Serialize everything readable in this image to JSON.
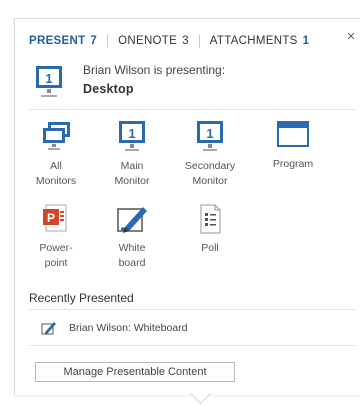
{
  "tabs": [
    {
      "label": "PRESENT",
      "count": "7"
    },
    {
      "label": "ONENOTE",
      "count": "3"
    },
    {
      "label": "ATTACHMENTS",
      "count": "1"
    }
  ],
  "close_glyph": "×",
  "presenting": {
    "status": "Brian Wilson is presenting:",
    "content": "Desktop",
    "monitor_digit": "1"
  },
  "options": [
    {
      "label": "All\nMonitors",
      "icon": "all-monitors-icon"
    },
    {
      "label": "Main\nMonitor",
      "icon": "monitor-icon",
      "digit": "1"
    },
    {
      "label": "Secondary\nMonitor",
      "icon": "monitor-icon",
      "digit": "1"
    },
    {
      "label": "Program",
      "icon": "program-window-icon"
    },
    {
      "label": "Power-\npoint",
      "icon": "powerpoint-icon",
      "letter": "P"
    },
    {
      "label": "White\nboard",
      "icon": "whiteboard-icon"
    },
    {
      "label": "Poll",
      "icon": "poll-icon"
    }
  ],
  "recent": {
    "title": "Recently Presented",
    "items": [
      {
        "label": "Brian Wilson:  Whiteboard",
        "icon": "whiteboard-icon"
      }
    ]
  },
  "manage_label": "Manage Presentable Content",
  "colors": {
    "accent": "#1f5fa7",
    "monitor_blue": "#2a6ab0",
    "powerpoint_orange": "#d24726"
  }
}
